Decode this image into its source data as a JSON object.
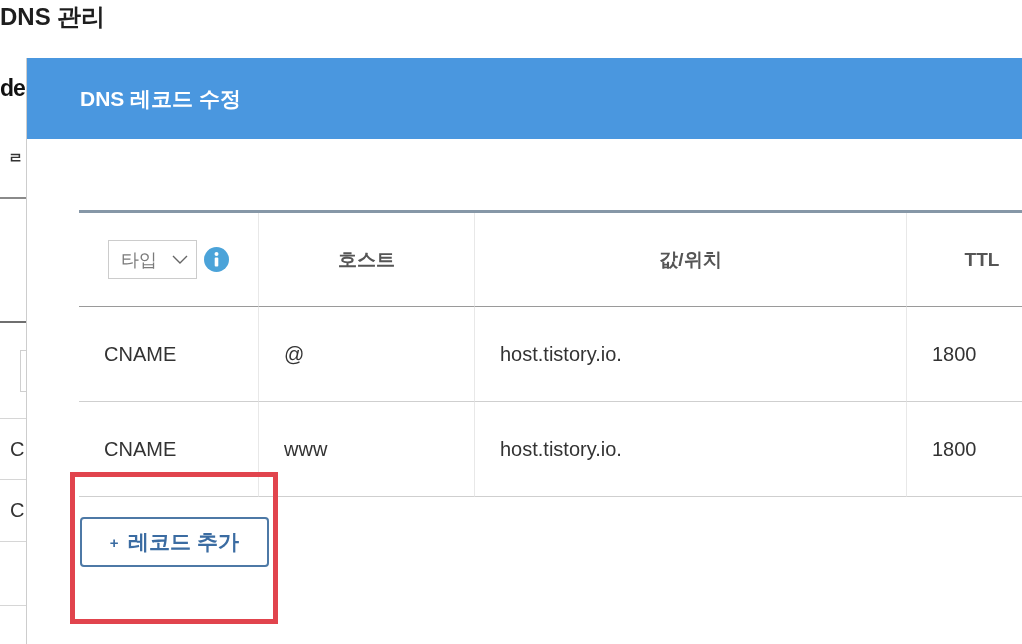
{
  "background_page": {
    "title": "DNS 관리",
    "subtitle": "de",
    "tab_fragment": "ㄹ",
    "row_fragments": [
      "C",
      "C"
    ]
  },
  "dialog": {
    "title": "DNS 레코드 수정",
    "table": {
      "type_filter": {
        "placeholder": "타입"
      },
      "columns": [
        "호스트",
        "값/위치",
        "TTL"
      ],
      "rows": [
        {
          "type": "CNAME",
          "host": "@",
          "value": "host.tistory.io.",
          "ttl": "1800"
        },
        {
          "type": "CNAME",
          "host": "www",
          "value": "host.tistory.io.",
          "ttl": "1800"
        }
      ]
    },
    "add_button": {
      "icon": "+",
      "label": "레코드 추가",
      "highlighted": true
    }
  }
}
